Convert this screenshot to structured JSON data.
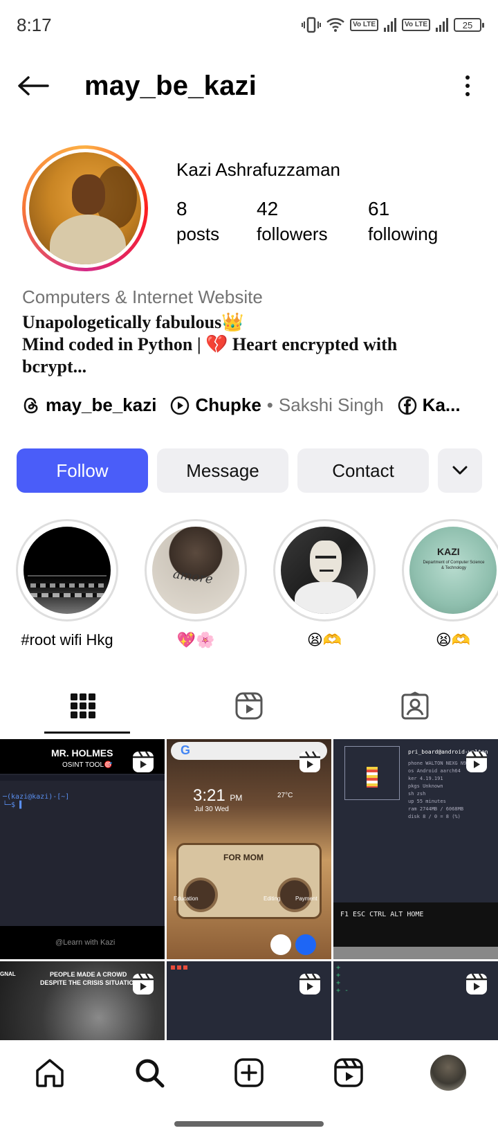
{
  "status_bar": {
    "time": "8:17",
    "volte": "Vo LTE",
    "battery": "25"
  },
  "header": {
    "username": "may_be_kazi"
  },
  "profile": {
    "display_name": "Kazi Ashrafuzzaman",
    "stats": [
      {
        "value": "8",
        "label": "posts"
      },
      {
        "value": "42",
        "label": "followers"
      },
      {
        "value": "61",
        "label": "following"
      }
    ],
    "category": "Computers & Internet Website",
    "bio_lines": [
      "Unapologetically fabulous👑",
      "Mind coded in Python  | 💔 Heart encrypted with",
      "bcrypt..."
    ],
    "links": {
      "threads_handle": "may_be_kazi",
      "music_title": "Chupke",
      "music_separator": " • ",
      "music_artist": "Sakshi Singh",
      "facebook_label": "Ka..."
    }
  },
  "actions": {
    "follow": "Follow",
    "message": "Message",
    "contact": "Contact"
  },
  "highlights": [
    {
      "label": "#root wifi Hkg"
    },
    {
      "label": "💖🌸"
    },
    {
      "label": "😫🫶"
    },
    {
      "label": "😫🫶"
    }
  ],
  "highlight_texts": {
    "amore": "amore",
    "kazi": "KAZI",
    "kazi_sub": "Department of Computer Science & Technology"
  },
  "posts": {
    "p1_title": "MR. HOLMES",
    "p1_sub": "OSINT TOOL🎯",
    "p1_footer": "@Learn with Kazi",
    "p2_time": "3:21",
    "p2_ampm": "PM",
    "p2_date": "Jul 30 Wed",
    "p2_temp": "27°C",
    "p2_radio": "FOR MOM",
    "p2_app1": "Education",
    "p2_app2": "Editing",
    "p2_app3": "Payment",
    "p3_title": "pri_board@android-walton",
    "p3_keys": "F1  ESC  CTRL  ALT    HOME",
    "p4_title": "PEOPLE MADE A CROWD",
    "p4_sub": "DESPITE THE CRISIS SITUATION",
    "p4_left": "GNAL"
  },
  "colors": {
    "follow_button": "#4a5df9",
    "secondary_button": "#efeff2",
    "muted_text": "#737373",
    "post_dark": "#2a2b36"
  }
}
